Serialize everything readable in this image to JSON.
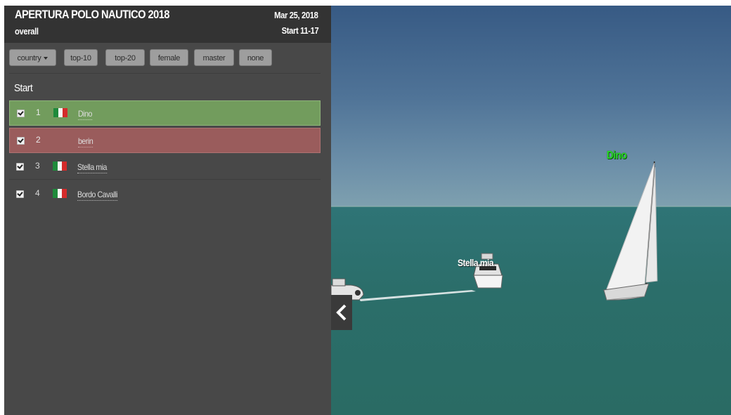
{
  "header": {
    "title": "APERTURA POLO NAUTICO 2018",
    "subtitle": "overall",
    "date": "Mar 25, 2018",
    "start": "Start 11-17"
  },
  "filters": [
    {
      "label": "country",
      "has_caret": true
    },
    {
      "label": "top-10"
    },
    {
      "label": "top-20"
    },
    {
      "label": "female"
    },
    {
      "label": "master"
    },
    {
      "label": "none"
    }
  ],
  "section_title": "Start",
  "boats": [
    {
      "rank": "1",
      "name": "Dino",
      "flag": "italy-flag-icon",
      "checked": true,
      "highlight": "#729c5d"
    },
    {
      "rank": "2",
      "name": "berin",
      "flag": "",
      "checked": true,
      "highlight": "#9a5c5c"
    },
    {
      "rank": "3",
      "name": "Stella mia",
      "flag": "italy-flag-icon",
      "checked": true
    },
    {
      "rank": "4",
      "name": "Bordo Cavalli",
      "flag": "italy-flag-icon",
      "checked": true
    }
  ],
  "scene": {
    "labels": {
      "dino": "Dino",
      "stella": "Stella mia"
    },
    "collapse_icon": "chevron-left-icon"
  },
  "colors": {
    "panel_bg": "#484848",
    "header_bg": "#333333",
    "row_leader": "#729c5d",
    "row_second": "#9a5c5c",
    "label_green": "#2ad72a",
    "sky": "#4f7397",
    "sea": "#2b6e6a"
  }
}
